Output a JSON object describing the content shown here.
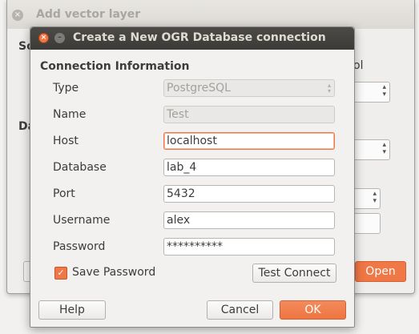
{
  "background_window": {
    "title": "Add vector layer",
    "source_label": "So",
    "database_label": "Da",
    "encoding_label_fragment": "ol",
    "open_button": "Open"
  },
  "dialog": {
    "title": "Create a New OGR Database connection",
    "section_title": "Connection Information",
    "fields": {
      "type": {
        "label": "Type",
        "value": "PostgreSQL"
      },
      "name": {
        "label": "Name",
        "value": "Test"
      },
      "host": {
        "label": "Host",
        "value": "localhost"
      },
      "database": {
        "label": "Database",
        "value": "lab_4"
      },
      "port": {
        "label": "Port",
        "value": "5432"
      },
      "username": {
        "label": "Username",
        "value": "alex"
      },
      "password": {
        "label": "Password",
        "value": "**********"
      }
    },
    "save_password_label": "Save Password",
    "test_connect_button": "Test Connect",
    "help_button": "Help",
    "cancel_button": "Cancel",
    "ok_button": "OK"
  },
  "colors": {
    "accent": "#f07746",
    "titlebar": "#3c3b37"
  }
}
